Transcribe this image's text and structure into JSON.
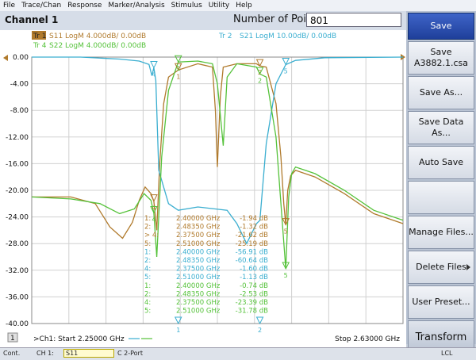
{
  "menu": [
    "File",
    "Trace/Chan",
    "Response",
    "Marker/Analysis",
    "Stimulus",
    "Utility",
    "Help"
  ],
  "channel_title": "Channel 1",
  "number_of_points": {
    "label": "Number of Points",
    "value": "801"
  },
  "traces": [
    {
      "id": "Tr 1",
      "label": "S11 LogM 4.000dB/  0.00dB",
      "color": "#b07a2c"
    },
    {
      "id": "Tr 2",
      "label": "S21 LogM 10.00dB/  0.00dB",
      "color": "#3aaed0"
    },
    {
      "id": "Tr 4",
      "label": "S22 LogM 4.000dB/  0.00dB",
      "color": "#55c23a"
    }
  ],
  "y_ticks": [
    "0.00",
    "-4.00",
    "-8.00",
    "-12.00",
    "-16.00",
    "-20.00",
    "-24.00",
    "-28.00",
    "-32.00",
    "-36.00",
    "-40.00"
  ],
  "markers": [
    {
      "num": "1:",
      "freq": "2.40000 GHz",
      "val": "-1.94 dB",
      "color": "#b07a2c"
    },
    {
      "num": "2:",
      "freq": "2.48350 GHz",
      "val": "-1.32 dB",
      "color": "#b07a2c"
    },
    {
      "num": "> 4:",
      "freq": "2.37500 GHz",
      "val": "-21.62 dB",
      "color": "#b07a2c"
    },
    {
      "num": "5:",
      "freq": "2.51000 GHz",
      "val": "-25.19 dB",
      "color": "#b07a2c"
    },
    {
      "num": "1:",
      "freq": "2.40000 GHz",
      "val": "-56.91 dB",
      "color": "#3aaed0"
    },
    {
      "num": "2:",
      "freq": "2.48350 GHz",
      "val": "-60.64 dB",
      "color": "#3aaed0"
    },
    {
      "num": "4:",
      "freq": "2.37500 GHz",
      "val": "-1.60 dB",
      "color": "#3aaed0"
    },
    {
      "num": "5:",
      "freq": "2.51000 GHz",
      "val": "-1.13 dB",
      "color": "#3aaed0"
    },
    {
      "num": "1:",
      "freq": "2.40000 GHz",
      "val": "-0.74 dB",
      "color": "#55c23a"
    },
    {
      "num": "2:",
      "freq": "2.48350 GHz",
      "val": "-2.53 dB",
      "color": "#55c23a"
    },
    {
      "num": "4:",
      "freq": "2.37500 GHz",
      "val": "-23.39 dB",
      "color": "#55c23a"
    },
    {
      "num": "5:",
      "freq": "2.51000 GHz",
      "val": "-31.78 dB",
      "color": "#55c23a"
    }
  ],
  "footer": {
    "num": "1",
    "start": ">Ch1: Start  2.25000 GHz",
    "stop": "Stop  2.63000 GHz"
  },
  "sidebar": {
    "save": "Save",
    "save_file": [
      "Save",
      "A3882.1.csa"
    ],
    "save_as": "Save As...",
    "save_data_as": "Save Data As...",
    "auto_save": "Auto Save",
    "manage_files": "Manage Files...",
    "delete_files": "Delete Files",
    "user_preset": "User Preset...",
    "transform": "Transform"
  },
  "status": {
    "cont": "Cont.",
    "ch": "CH 1:",
    "param": "S11",
    "port": "C  2-Port",
    "lcl": "LCL"
  },
  "chart_data": {
    "type": "line",
    "xlabel": "",
    "ylabel": "",
    "xlim": [
      2.25,
      2.63
    ],
    "ylim": [
      -40,
      0
    ],
    "grid": true,
    "series": [
      {
        "name": "S11",
        "color": "#b07a2c",
        "x": [
          2.25,
          2.29,
          2.315,
          2.33,
          2.343,
          2.353,
          2.36,
          2.366,
          2.372,
          2.375,
          2.378,
          2.381,
          2.385,
          2.39,
          2.4,
          2.42,
          2.435,
          2.438,
          2.44,
          2.443,
          2.446,
          2.46,
          2.48,
          2.4835,
          2.49,
          2.5,
          2.505,
          2.508,
          2.51,
          2.512,
          2.515,
          2.52,
          2.54,
          2.57,
          2.6,
          2.63
        ],
        "y": [
          -21,
          -21,
          -22,
          -25.5,
          -27.2,
          -24.8,
          -21.5,
          -19.5,
          -20.5,
          -21.62,
          -26,
          -16,
          -7,
          -3,
          -1.94,
          -1,
          -1.5,
          -8,
          -16.5,
          -6,
          -1.5,
          -1,
          -1,
          -1.32,
          -1.5,
          -7,
          -15,
          -22,
          -25.19,
          -20,
          -17.8,
          -17,
          -18,
          -20.5,
          -23.5,
          -25
        ]
      },
      {
        "name": "S21",
        "color": "#3aaed0",
        "x": [
          2.25,
          2.3,
          2.34,
          2.36,
          2.37,
          2.373,
          2.375,
          2.377,
          2.38,
          2.39,
          2.4,
          2.42,
          2.45,
          2.46,
          2.47,
          2.48,
          2.4835,
          2.49,
          2.5,
          2.51,
          2.52,
          2.55,
          2.63
        ],
        "y": [
          0,
          0,
          -0.3,
          -0.6,
          -1.1,
          -2.8,
          -1.6,
          -3.5,
          -17,
          -22,
          -23,
          -22.5,
          -23,
          -25,
          -28,
          -25,
          -24.5,
          -13,
          -4,
          -1.13,
          -0.5,
          -0.1,
          0
        ]
      },
      {
        "name": "S22",
        "color": "#55c23a",
        "x": [
          2.25,
          2.29,
          2.32,
          2.34,
          2.355,
          2.365,
          2.372,
          2.375,
          2.378,
          2.383,
          2.39,
          2.4,
          2.42,
          2.435,
          2.44,
          2.446,
          2.45,
          2.46,
          2.48,
          2.4835,
          2.49,
          2.5,
          2.505,
          2.51,
          2.513,
          2.516,
          2.52,
          2.54,
          2.57,
          2.6,
          2.63
        ],
        "y": [
          -21,
          -21.3,
          -22,
          -23.5,
          -22.8,
          -20.5,
          -21.5,
          -23.39,
          -30,
          -15,
          -5,
          -0.74,
          -0.6,
          -1,
          -4,
          -13.3,
          -3,
          -1,
          -1.5,
          -2.53,
          -3,
          -12,
          -22,
          -31.78,
          -21,
          -17.5,
          -16.5,
          -17.5,
          -20,
          -23,
          -24.5
        ]
      }
    ]
  }
}
